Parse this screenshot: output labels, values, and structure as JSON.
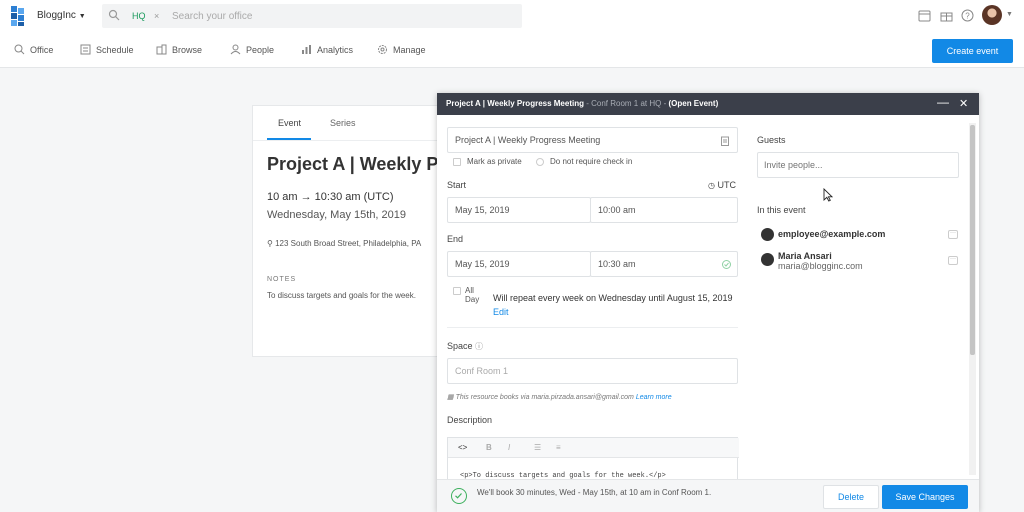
{
  "header": {
    "org_name": "BloggInc",
    "search_chip": "HQ",
    "search_chip_close": "×",
    "search_placeholder": "Search your office"
  },
  "nav": {
    "items": [
      {
        "label": "Office",
        "icon": "office-icon"
      },
      {
        "label": "Schedule",
        "icon": "schedule-icon"
      },
      {
        "label": "Browse",
        "icon": "browse-icon"
      },
      {
        "label": "People",
        "icon": "people-icon"
      },
      {
        "label": "Analytics",
        "icon": "analytics-icon"
      },
      {
        "label": "Manage",
        "icon": "gear-icon"
      }
    ],
    "create_label": "Create event"
  },
  "event_card": {
    "tabs": [
      "Event",
      "Series"
    ],
    "title": "Project A | Weekly Progress Meeting",
    "time": "10 am → 10:30 am (UTC)",
    "date": "Wednesday, May 15th, 2019",
    "address": "123 South Broad Street, Philadelphia, PA",
    "notes_heading": "NOTES",
    "notes": "To discuss targets and goals for the week."
  },
  "modal": {
    "header_title": "Project A | Weekly Progress Meeting",
    "header_location": " - Conf Room 1 at  HQ  - ",
    "header_status": "(Open Event)",
    "minimize": "—",
    "close": "✕",
    "title_value": "Project A | Weekly Progress Meeting",
    "mark_private": "Mark as private",
    "no_checkin": "Do not require check in",
    "start_label": "Start",
    "timezone": "UTC",
    "start_date": "May 15, 2019",
    "start_time": "10:00 am",
    "end_label": "End",
    "end_date": "May 15, 2019",
    "end_time": "10:30 am",
    "all_day_1": "All",
    "all_day_2": "Day",
    "repeat_text": "Will repeat every week on Wednesday until August 15, 2019",
    "repeat_edit": "Edit",
    "space_label": "Space",
    "space_placeholder": "Conf Room 1",
    "resource_note": "This resource books via maria.pirzada.ansari@gmail.com",
    "resource_link": "Learn more",
    "description_label": "Description",
    "description_code": "<p>To discuss targets and goals for the week.</p>",
    "toolbar": {
      "code": "<>",
      "bold": "B",
      "italic": "I",
      "ul": "☰",
      "ol": "≡"
    },
    "guests_label": "Guests",
    "guests_placeholder": "Invite people...",
    "in_event_label": "In this event",
    "guests": [
      {
        "name": "employee@example.com",
        "email": ""
      },
      {
        "name": "Maria Ansari",
        "email": "maria@blogginc.com"
      }
    ],
    "more_glyph": "···",
    "footer_text": "We'll book 30 minutes, Wed - May 15th, at 10 am in Conf Room 1.",
    "delete_label": "Delete",
    "save_label": "Save Changes"
  },
  "colors": {
    "accent": "#1289e6",
    "header": "#3b3f4a",
    "success": "#3db05e"
  }
}
